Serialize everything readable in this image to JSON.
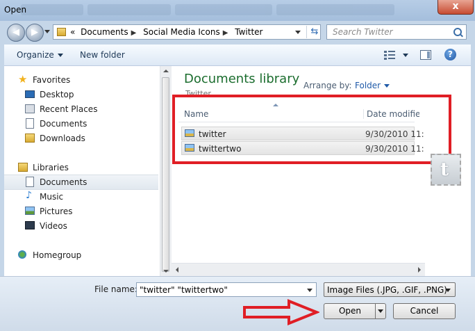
{
  "window": {
    "title": "Open",
    "close_label": "x"
  },
  "nav": {
    "back_label": "◀",
    "forward_label": "▶",
    "breadcrumb_prefix": "«",
    "breadcrumb": [
      "Documents",
      "Social Media Icons",
      "Twitter"
    ],
    "search_placeholder": "Search Twitter"
  },
  "toolbar": {
    "organize_label": "Organize",
    "new_folder_label": "New folder",
    "help_label": "?"
  },
  "sidebar": {
    "favorites": {
      "label": "Favorites",
      "items": [
        "Desktop",
        "Recent Places",
        "Documents",
        "Downloads"
      ]
    },
    "libraries": {
      "label": "Libraries",
      "items": [
        "Documents",
        "Music",
        "Pictures",
        "Videos"
      ],
      "selected": "Documents"
    },
    "homegroup": "Homegroup"
  },
  "content": {
    "title": "Documents library",
    "subtitle": "Twitter",
    "arrange_label": "Arrange by:",
    "arrange_value": "Folder",
    "columns": {
      "name": "Name",
      "date": "Date modified"
    },
    "files": [
      {
        "name": "twitter",
        "date": "9/30/2010 11:"
      },
      {
        "name": "twittertwo",
        "date": "9/30/2010 11:"
      }
    ]
  },
  "bottom": {
    "file_name_label": "File name:",
    "file_name_value": "\"twitter\" \"twittertwo\"",
    "filter_value": "Image Files (.JPG, .GIF, .PNG)",
    "open_label": "Open",
    "cancel_label": "Cancel"
  },
  "colors": {
    "highlight": "#e01e25",
    "library_title": "#1b6d2e",
    "link": "#1f5aa8"
  },
  "icons": [
    "star-icon",
    "desktop-icon",
    "recent-places-icon",
    "documents-icon",
    "downloads-icon",
    "libraries-icon",
    "music-icon",
    "pictures-icon",
    "videos-icon",
    "homegroup-icon",
    "image-file-icon",
    "search-icon",
    "refresh-icon",
    "help-icon"
  ]
}
